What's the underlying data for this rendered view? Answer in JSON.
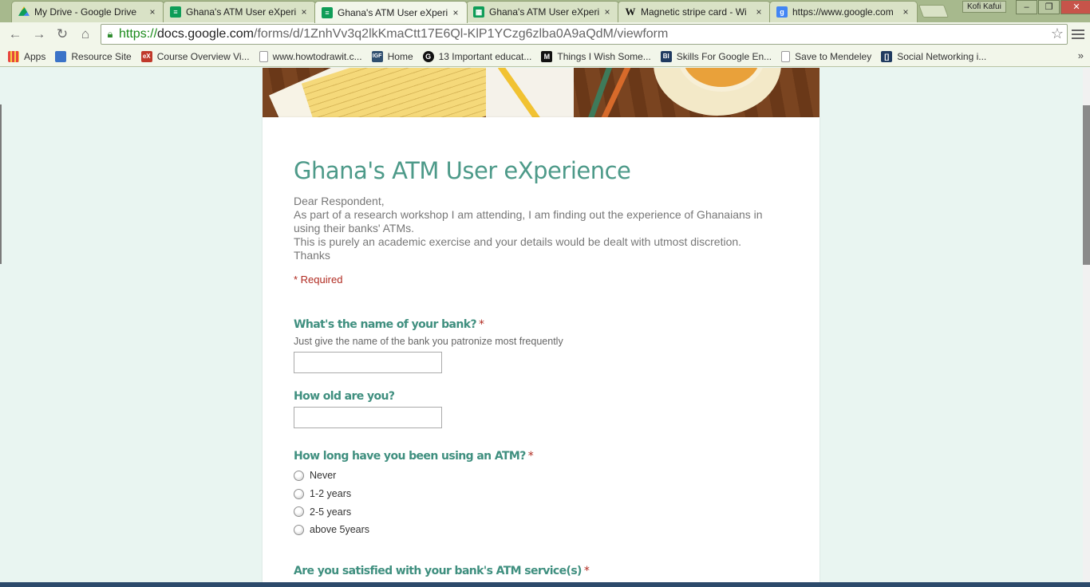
{
  "browser": {
    "tabs": [
      {
        "title": "My Drive - Google Drive",
        "favicon": "google-drive-icon",
        "color": "#f4b400"
      },
      {
        "title": "Ghana's ATM User eXperi",
        "favicon": "google-forms-icon",
        "color": "#0f9d58"
      },
      {
        "title": "Ghana's ATM User eXperi",
        "favicon": "google-forms-icon",
        "color": "#0f9d58"
      },
      {
        "title": "Ghana's ATM User eXperi",
        "favicon": "google-sheets-icon",
        "color": "#0f9d58"
      },
      {
        "title": "Magnetic stripe card - Wi",
        "favicon": "wikipedia-icon",
        "color": "#ffffff"
      },
      {
        "title": "https://www.google.com",
        "favicon": "google-icon",
        "color": "#4285f4"
      }
    ],
    "tab_close_glyph": "×",
    "profile_name": "Kofi Kafui",
    "url": {
      "scheme": "https://",
      "host": "docs.google.com",
      "path": "/forms/d/1ZnhVv3q2lkKmaCtt17E6Ql-KlP1YCzg6zlba0A9aQdM/viewform"
    },
    "bookmarks": [
      {
        "label": "Apps",
        "icon": "apps-grid-icon",
        "color": "#e8453c"
      },
      {
        "label": "Resource Site",
        "icon": "page-blue-icon",
        "color": "#3b73c8"
      },
      {
        "label": "Course Overview Vi...",
        "icon": "edx-icon",
        "color": "#c0392b"
      },
      {
        "label": "www.howtodrawit.c...",
        "icon": "blank-page-icon",
        "color": "#ffffff"
      },
      {
        "label": "Home",
        "icon": "igf-icon",
        "color": "#2f4f6f"
      },
      {
        "label": "13 Important educat...",
        "icon": "g-circle-icon",
        "color": "#111111"
      },
      {
        "label": "Things I Wish Some...",
        "icon": "medium-icon",
        "color": "#111111"
      },
      {
        "label": "Skills For Google En...",
        "icon": "bi-icon",
        "color": "#1f3a60"
      },
      {
        "label": "Save to Mendeley",
        "icon": "blank-page-icon",
        "color": "#ffffff"
      },
      {
        "label": "Social Networking i...",
        "icon": "bracket-icon",
        "color": "#1f3a60"
      }
    ],
    "bookmarks_overflow": "»"
  },
  "form": {
    "title": "Ghana's ATM User eXperience",
    "description": [
      "Dear Respondent,",
      "As part of a research workshop I am attending, I am finding out the experience of Ghanaians in using their banks' ATMs.",
      "This is purely an academic exercise and your details would be dealt with utmost discretion.",
      "Thanks"
    ],
    "required_note": "* Required",
    "required_marker": "*",
    "questions": {
      "bank": {
        "title": "What's the name of your bank?",
        "help": "Just give the name of the bank you patronize most frequently",
        "value": ""
      },
      "age": {
        "title": "How old are you?",
        "value": ""
      },
      "duration": {
        "title": "How long have you been using an ATM?",
        "options": [
          "Never",
          "1-2 years",
          "2-5 years",
          "above 5years"
        ]
      },
      "satisfied": {
        "title": "Are you satisfied with your bank's ATM service(s)"
      }
    }
  }
}
